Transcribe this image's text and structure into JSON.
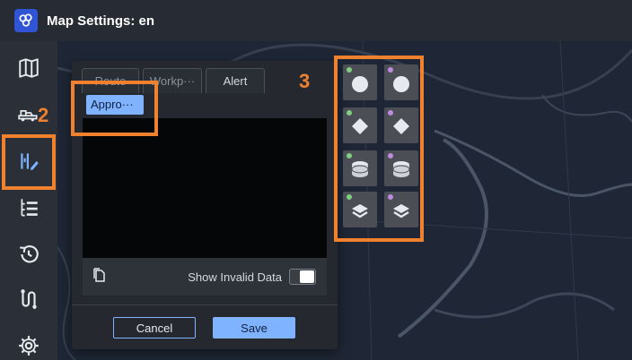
{
  "window": {
    "title": "Map Settings: en"
  },
  "sidebar": {
    "items": [
      {
        "name": "map-icon"
      },
      {
        "name": "truck-icon"
      },
      {
        "name": "layer-settings-icon"
      },
      {
        "name": "list-icon"
      },
      {
        "name": "history-icon"
      },
      {
        "name": "route-icon"
      },
      {
        "name": "gear-icon"
      }
    ]
  },
  "panel": {
    "tabs": [
      {
        "label": "Route"
      },
      {
        "label": "Workp···"
      },
      {
        "label": "Alert"
      }
    ],
    "selected_chip": "Appro···",
    "footer": {
      "invalid_label": "Show Invalid Data",
      "toggle_on": false
    },
    "buttons": {
      "cancel": "Cancel",
      "save": "Save"
    }
  },
  "annotations": {
    "step_a": "2",
    "step_b": "3"
  },
  "palette": {
    "cells": [
      {
        "shape": "circle",
        "dot_color": "#7ed07e"
      },
      {
        "shape": "circle",
        "dot_color": "#c08ae0"
      },
      {
        "shape": "diamond",
        "dot_color": "#7ed07e"
      },
      {
        "shape": "diamond",
        "dot_color": "#c08ae0"
      },
      {
        "shape": "cylinder",
        "dot_color": "#7ed07e"
      },
      {
        "shape": "cylinder",
        "dot_color": "#c08ae0"
      },
      {
        "shape": "layers",
        "dot_color": "#7ed07e"
      },
      {
        "shape": "layers",
        "dot_color": "#c08ae0"
      }
    ]
  },
  "colors": {
    "accent": "#7fb2ff",
    "highlight": "#f0812e",
    "brand": "#2f55d4"
  }
}
